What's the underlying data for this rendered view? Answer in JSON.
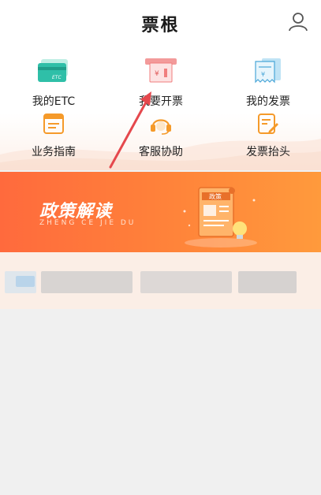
{
  "header": {
    "title": "票根",
    "user_icon": "user-icon"
  },
  "menu": {
    "items": [
      {
        "label": "我的ETC",
        "icon": "etc-card-icon"
      },
      {
        "label": "我要开票",
        "icon": "invoice-print-icon"
      },
      {
        "label": "我的发票",
        "icon": "invoice-receipt-icon"
      },
      {
        "label": "业务指南",
        "icon": "guide-icon"
      },
      {
        "label": "客服协助",
        "icon": "headset-icon"
      },
      {
        "label": "发票抬头",
        "icon": "edit-title-icon"
      }
    ]
  },
  "banner": {
    "title": "政策解读",
    "subtitle": "ZHENG CE JIE DU",
    "doc_label": "政策"
  },
  "colors": {
    "accent": "#ff6a3d",
    "banner_end": "#ff9a3c",
    "teal": "#2fbfa8",
    "orange": "#f59a2a",
    "annotation": "#e5484d"
  }
}
